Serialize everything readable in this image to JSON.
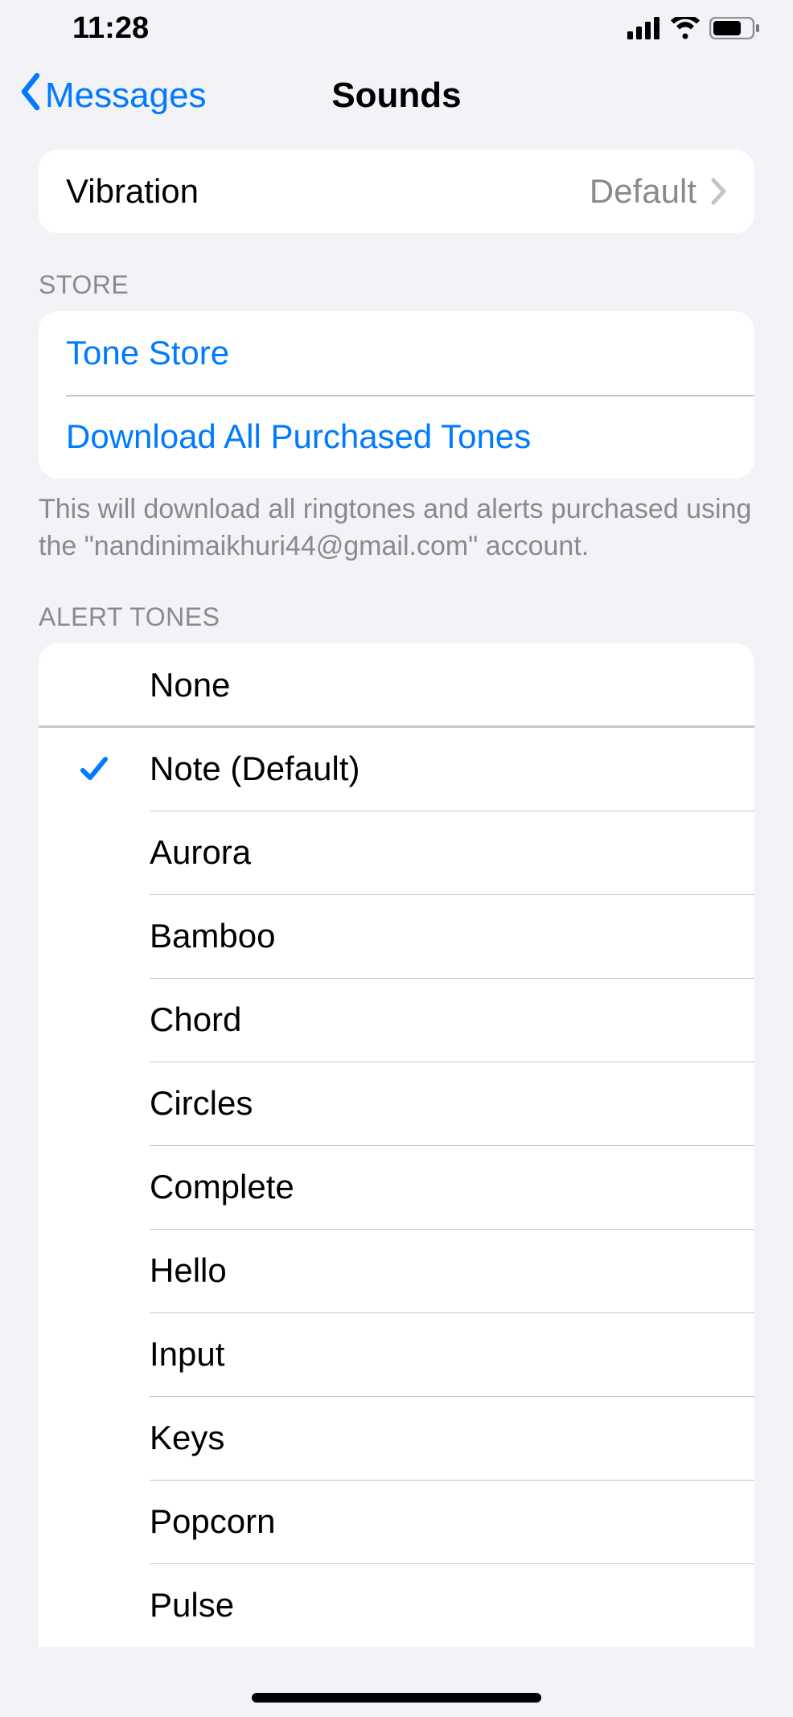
{
  "status": {
    "time": "11:28"
  },
  "nav": {
    "back_label": "Messages",
    "title": "Sounds"
  },
  "vibration": {
    "label": "Vibration",
    "value": "Default"
  },
  "store": {
    "header": "STORE",
    "tone_store": "Tone Store",
    "download_all": "Download All Purchased Tones",
    "footer": "This will download all ringtones and alerts purchased using the \"nandinimaikhuri44@gmail.com\" account."
  },
  "alerts": {
    "header": "ALERT TONES",
    "items": [
      {
        "label": "None",
        "selected": false
      },
      {
        "label": "Note (Default)",
        "selected": true
      },
      {
        "label": "Aurora",
        "selected": false
      },
      {
        "label": "Bamboo",
        "selected": false
      },
      {
        "label": "Chord",
        "selected": false
      },
      {
        "label": "Circles",
        "selected": false
      },
      {
        "label": "Complete",
        "selected": false
      },
      {
        "label": "Hello",
        "selected": false
      },
      {
        "label": "Input",
        "selected": false
      },
      {
        "label": "Keys",
        "selected": false
      },
      {
        "label": "Popcorn",
        "selected": false
      },
      {
        "label": "Pulse",
        "selected": false
      }
    ]
  }
}
